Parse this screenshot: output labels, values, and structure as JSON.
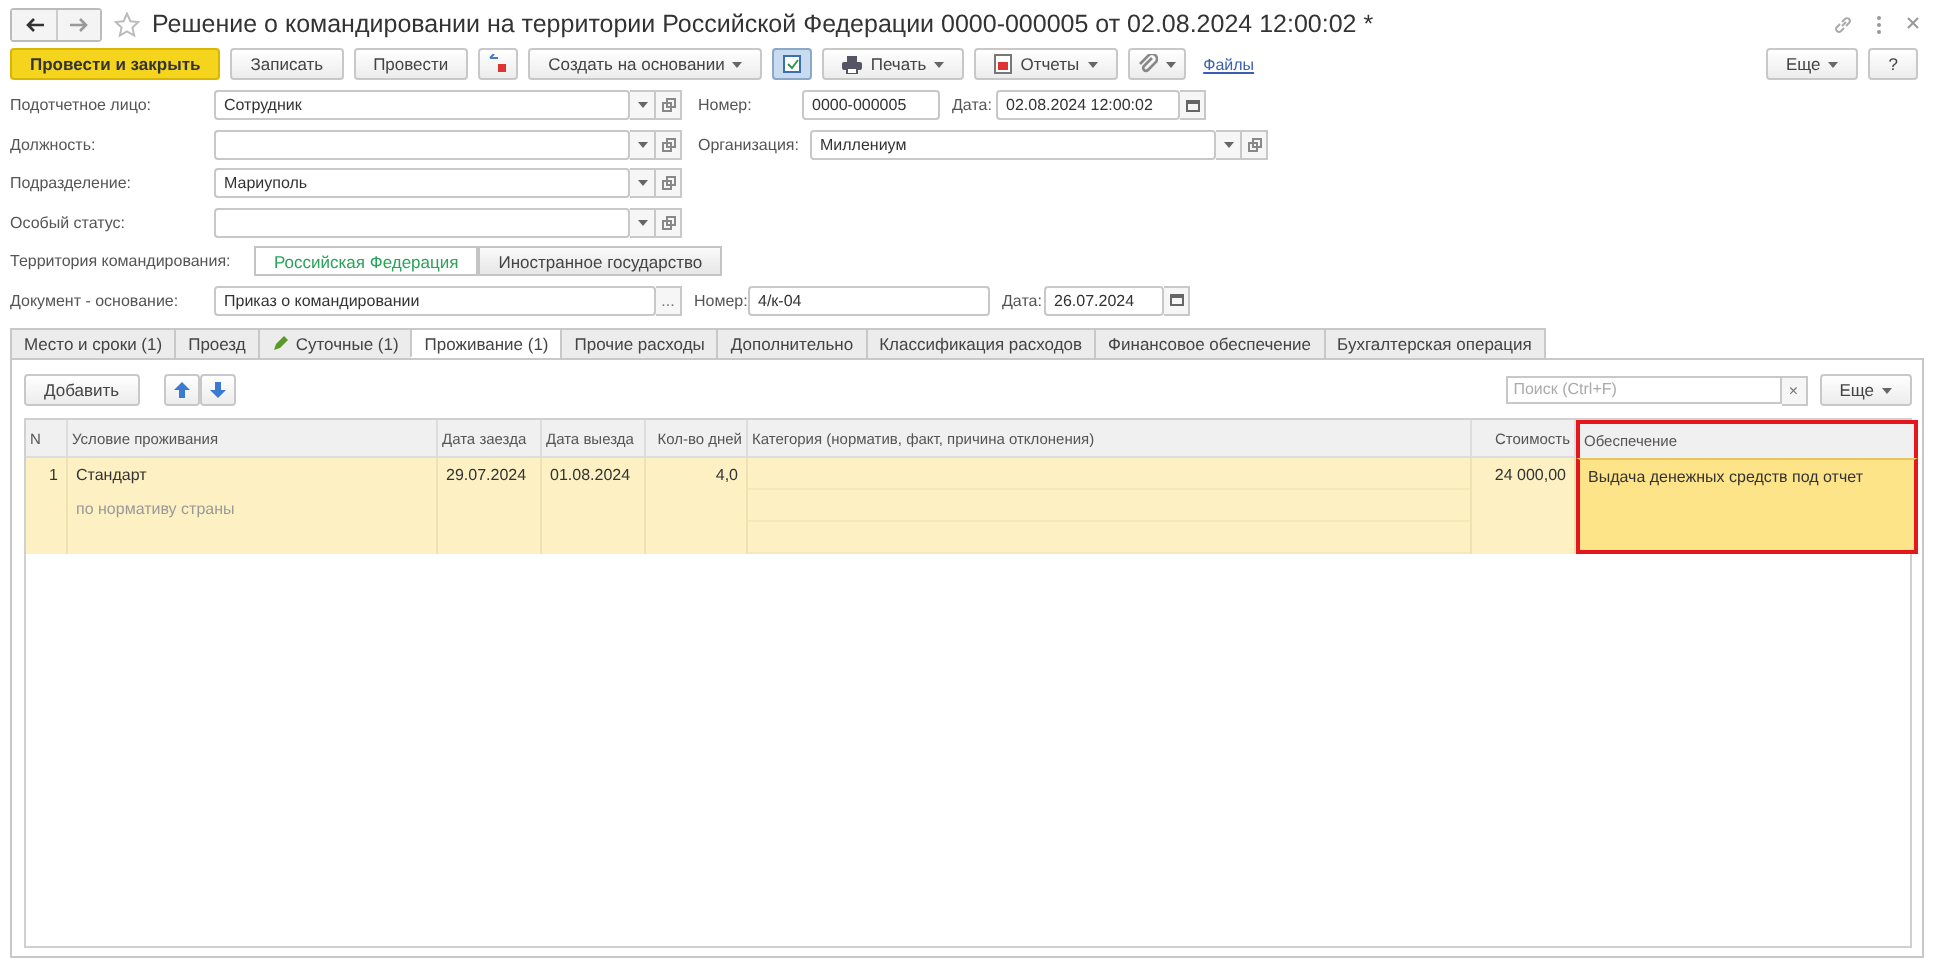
{
  "window": {
    "title": "Решение о командировании на территории Российской Федерации 0000-000005 от 02.08.2024 12:00:02 *"
  },
  "toolbar": [
    {
      "kind": "primary",
      "label": "Провести и закрыть"
    },
    {
      "kind": "plain",
      "label": "Записать"
    },
    {
      "kind": "plain",
      "label": "Провести"
    },
    {
      "kind": "transfer"
    },
    {
      "kind": "menu",
      "label": "Создать на основании"
    },
    {
      "kind": "toggle"
    },
    {
      "kind": "print",
      "label": "Печать"
    },
    {
      "kind": "report",
      "label": "Отчеты"
    },
    {
      "kind": "clip"
    },
    {
      "kind": "link",
      "label": "Файлы"
    }
  ],
  "toolbar_right": [
    {
      "kind": "menu",
      "label": "Еще"
    },
    {
      "kind": "plain",
      "label": "?"
    }
  ],
  "fields": [
    {
      "label": "Подотчетное лицо:",
      "value": "Сотрудник"
    },
    {
      "label": "Должность:"
    },
    {
      "label": "Подразделение:",
      "value": "Мариуполь"
    },
    {
      "label": "Особый статус:"
    }
  ],
  "number": {
    "label": "Номер:",
    "value": "0000-000005"
  },
  "date": {
    "label": "Дата:",
    "value": "02.08.2024 12:00:02"
  },
  "organization": {
    "label": "Организация:",
    "value": "Миллениум"
  },
  "territory": {
    "label": "Территория командирования:",
    "options": [
      {
        "label": "Российская Федерация",
        "selected": true
      },
      {
        "label": "Иностранное государство",
        "selected": false
      }
    ]
  },
  "basis": {
    "label": "Документ - основание:",
    "value": "Приказ о командировании",
    "select": "...",
    "number_label": "Номер:",
    "number": "4/к-04",
    "date_label": "Дата:",
    "date": "26.07.2024"
  },
  "tabs": [
    {
      "label": "Место и сроки (1)",
      "selected": false,
      "edited": false
    },
    {
      "label": "Проезд",
      "selected": false,
      "edited": false
    },
    {
      "label": "Суточные (1)",
      "selected": false,
      "edited": true
    },
    {
      "label": "Проживание (1)",
      "selected": true,
      "edited": false
    },
    {
      "label": "Прочие расходы",
      "selected": false,
      "edited": false
    },
    {
      "label": "Дополнительно",
      "selected": false,
      "edited": false
    },
    {
      "label": "Классификация расходов",
      "selected": false,
      "edited": false
    },
    {
      "label": "Финансовое обеспечение",
      "selected": false,
      "edited": false
    },
    {
      "label": "Бухгалтерская операция",
      "selected": false,
      "edited": false
    }
  ],
  "table_toolbar": {
    "add": "Добавить",
    "search": {
      "placeholder": "Поиск (Ctrl+F)"
    },
    "clear": "×",
    "more": "Еще"
  },
  "table": {
    "columns": [
      {
        "label": "N",
        "highlighted": false
      },
      {
        "label": "Условие проживания",
        "highlighted": false
      },
      {
        "label": "Дата заезда",
        "highlighted": false
      },
      {
        "label": "Дата выезда",
        "highlighted": false
      },
      {
        "label": "Кол-во дней",
        "highlighted": false
      },
      {
        "label": "Категория (норматив, факт, причина отклонения)",
        "highlighted": false
      },
      {
        "label": "Стоимость",
        "highlighted": false
      },
      {
        "label": "Обеспечение",
        "highlighted": true
      }
    ],
    "rows": [
      {
        "selected": true,
        "cells": [
          "1",
          "Стандарт",
          "29.07.2024",
          "01.08.2024",
          "4,0",
          "",
          "24 000,00",
          "Выдача денежных средств под отчет"
        ],
        "subtext": "по нормативу страны"
      }
    ]
  }
}
